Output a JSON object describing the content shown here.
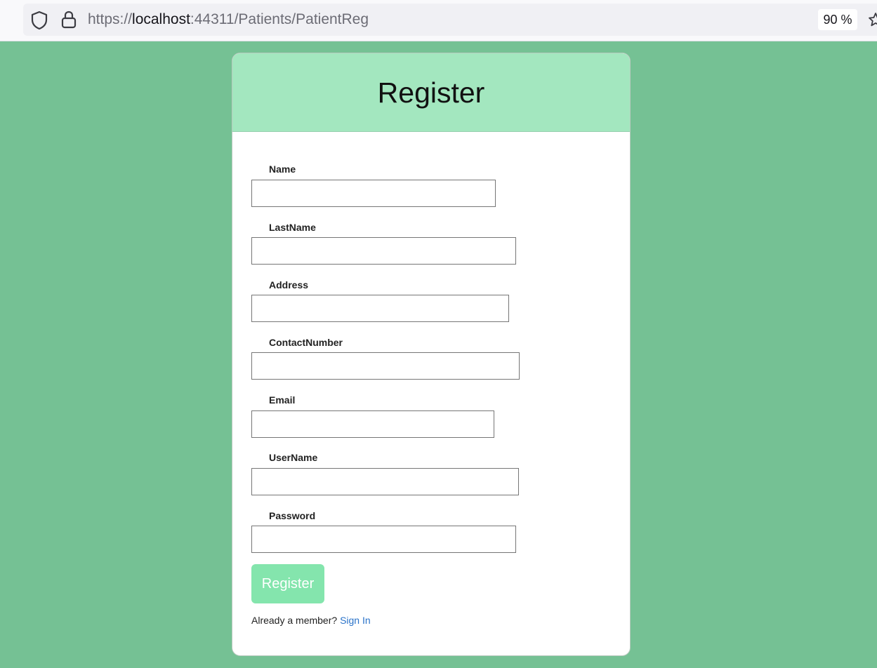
{
  "browser": {
    "url_scheme": "https://",
    "url_host": "localhost",
    "url_rest": ":44311/Patients/PatientReg",
    "zoom": "90 %",
    "icons": [
      "shield-icon",
      "lock-icon",
      "star-icon"
    ]
  },
  "colors": {
    "page_background": "#75c194",
    "header_background": "#a3e7bf",
    "button_background": "#84e5ad",
    "link": "#2a73c9"
  },
  "form": {
    "title": "Register",
    "fields": [
      {
        "label": "Name",
        "value": ""
      },
      {
        "label": "LastName",
        "value": ""
      },
      {
        "label": "Address",
        "value": ""
      },
      {
        "label": "ContactNumber",
        "value": ""
      },
      {
        "label": "Email",
        "value": ""
      },
      {
        "label": "UserName",
        "value": ""
      },
      {
        "label": "Password",
        "value": ""
      }
    ],
    "submit_label": "Register",
    "member_text": "Already a member?",
    "signin_label": "Sign In"
  }
}
